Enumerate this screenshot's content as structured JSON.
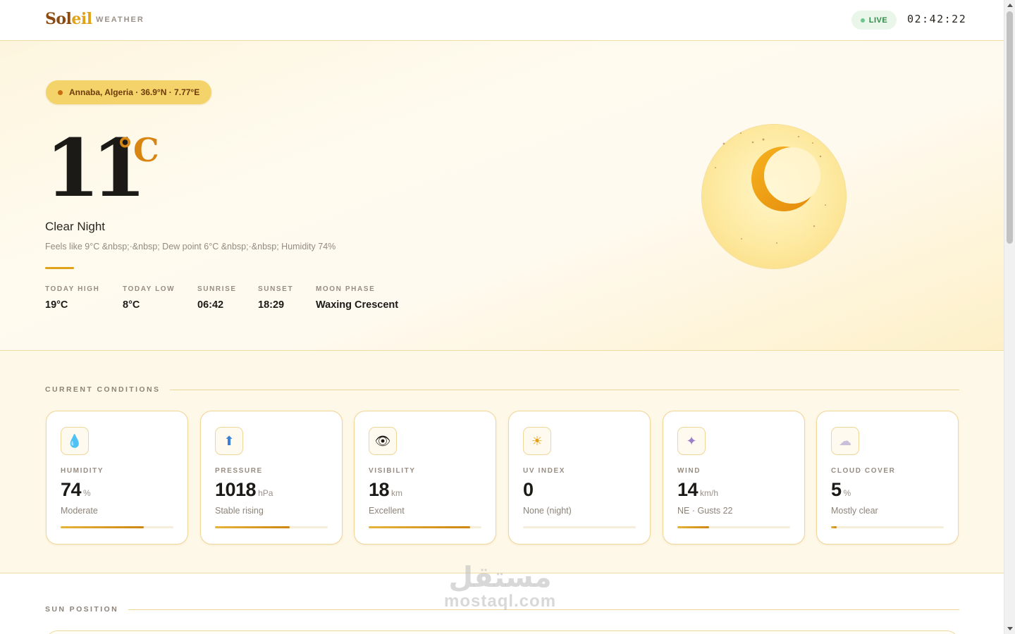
{
  "header": {
    "brand_main": "Sol",
    "brand_accent": "eil",
    "brand_sub": "WEATHER",
    "live_label": "LIVE",
    "clock": "02:42:22"
  },
  "hero": {
    "location": "Annaba, Algeria · 36.9°N · 7.77°E",
    "temperature": "11",
    "unit": "°C",
    "condition": "Clear Night",
    "details": "Feels like 9°C &nbsp;·&nbsp; Dew point 6°C &nbsp;·&nbsp; Humidity 74%",
    "stats": [
      {
        "label": "TODAY HIGH",
        "value": "19°C"
      },
      {
        "label": "TODAY LOW",
        "value": "8°C"
      },
      {
        "label": "SUNRISE",
        "value": "06:42"
      },
      {
        "label": "SUNSET",
        "value": "18:29"
      },
      {
        "label": "MOON PHASE",
        "value": "Waxing Crescent"
      }
    ],
    "sky_icon": "crescent-moon-icon"
  },
  "conditions": {
    "title": "CURRENT CONDITIONS",
    "cards": [
      {
        "icon": "droplet-icon",
        "glyph": "💧",
        "label": "HUMIDITY",
        "value": "74",
        "unit": "%",
        "note": "Moderate",
        "level": 0.74
      },
      {
        "icon": "arrow-up-icon",
        "glyph": "⬆",
        "label": "PRESSURE",
        "value": "1018",
        "unit": "hPa",
        "note": "Stable rising",
        "level": 0.66
      },
      {
        "icon": "eye-icon",
        "glyph": "👁",
        "label": "VISIBILITY",
        "value": "18",
        "unit": "km",
        "note": "Excellent",
        "level": 0.9
      },
      {
        "icon": "sun-icon",
        "glyph": "☀",
        "label": "UV INDEX",
        "value": "0",
        "unit": "",
        "note": "None (night)",
        "level": 0
      },
      {
        "icon": "wind-icon",
        "glyph": "✦",
        "label": "WIND",
        "value": "14",
        "unit": "km/h",
        "note": "NE · Gusts 22",
        "level": 0.28
      },
      {
        "icon": "cloud-icon",
        "glyph": "☁",
        "label": "CLOUD COVER",
        "value": "5",
        "unit": "%",
        "note": "Mostly clear",
        "level": 0.05
      }
    ]
  },
  "sun_position": {
    "title": "SUN POSITION"
  },
  "watermark": {
    "arabic": "مستقل",
    "latin": "mostaql.com"
  },
  "colors": {
    "accent": "#e0a21a",
    "brand": "#8a4a12",
    "live": "#2f8a48"
  }
}
